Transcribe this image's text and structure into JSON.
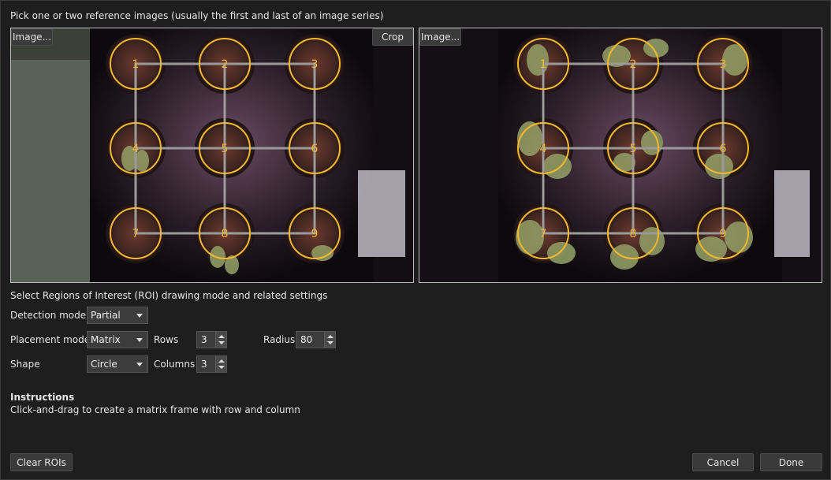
{
  "header": {
    "text": "Pick one or two reference images (usually the first and last of an image series)"
  },
  "left_panel": {
    "image_button": "Image...",
    "crop_button": "Crop",
    "roi_labels": [
      "1",
      "2",
      "3",
      "4",
      "5",
      "6",
      "7",
      "8",
      "9"
    ]
  },
  "right_panel": {
    "image_button": "Image...",
    "roi_labels": [
      "1",
      "2",
      "3",
      "4",
      "5",
      "6",
      "7",
      "8",
      "9"
    ]
  },
  "settings": {
    "title": "Select Regions of Interest (ROI) drawing mode and related settings",
    "detection_mode": {
      "label": "Detection mode",
      "value": "Partial"
    },
    "placement_mode": {
      "label": "Placement mode",
      "value": "Matrix"
    },
    "shape": {
      "label": "Shape",
      "value": "Circle"
    },
    "rows": {
      "label": "Rows",
      "value": "3"
    },
    "columns": {
      "label": "Columns",
      "value": "3"
    },
    "radius": {
      "label": "Radius",
      "value": "80"
    }
  },
  "instructions": {
    "title": "Instructions",
    "text": "Click-and-drag to create a matrix frame with row and column"
  },
  "footer": {
    "clear_rois": "Clear ROIs",
    "cancel": "Cancel",
    "done": "Done"
  },
  "colors": {
    "roi_circle": "#f5b82e",
    "grid_line": "#9a9a9a",
    "background": "#1e1e1e"
  }
}
